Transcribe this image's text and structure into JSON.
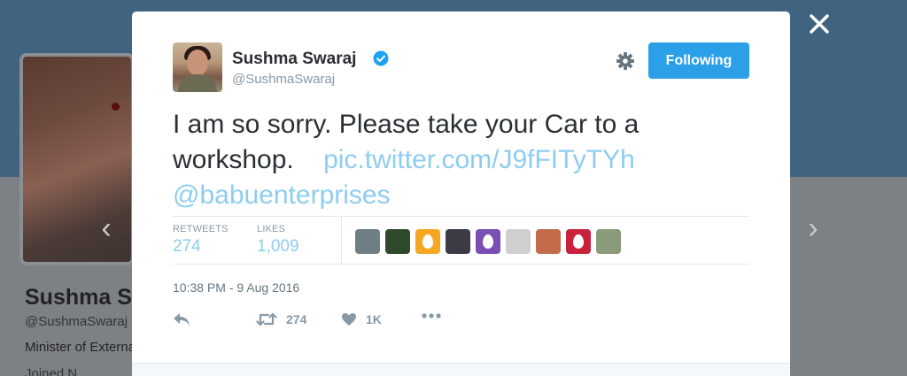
{
  "background": {
    "profile_name": "Sushma Swaraj",
    "profile_handle": "@SushmaSwaraj",
    "bio": "Minister of External Affairs",
    "joined": "Joined N"
  },
  "tweet": {
    "author_name": "Sushma Swaraj",
    "author_handle": "@SushmaSwaraj",
    "verified": true,
    "follow_label": "Following",
    "text": "I am so sorry. Please take your Car to a workshop.",
    "link": "pic.twitter.com/J9fFITyTYh",
    "mention": "@babuenterprises",
    "retweets_label": "RETWEETS",
    "retweets_value": "274",
    "likes_label": "LIKES",
    "likes_value": "1,009",
    "timestamp": "10:38 PM - 9 Aug 2016",
    "actions": {
      "reply_icon": "reply-icon",
      "retweet_count": "274",
      "like_count": "1K",
      "more_icon": "more-icon"
    },
    "liker_avatars": [
      {
        "icon": "liker-avatar",
        "color": "#6f7f86"
      },
      {
        "icon": "liker-avatar",
        "color": "#2f4a2a"
      },
      {
        "icon": "egg-avatar",
        "color": "#f5a623"
      },
      {
        "icon": "liker-avatar",
        "color": "#3c3a45"
      },
      {
        "icon": "egg-avatar",
        "color": "#7a4fb3"
      },
      {
        "icon": "liker-avatar",
        "color": "#cfcfcf"
      },
      {
        "icon": "liker-avatar",
        "color": "#c46b4c"
      },
      {
        "icon": "egg-avatar",
        "color": "#c9223d"
      },
      {
        "icon": "liker-avatar",
        "color": "#8b9a7a"
      }
    ]
  },
  "colors": {
    "accent": "#2b9fe8",
    "link": "#8ecdf0",
    "verified": "#1da1f2"
  }
}
